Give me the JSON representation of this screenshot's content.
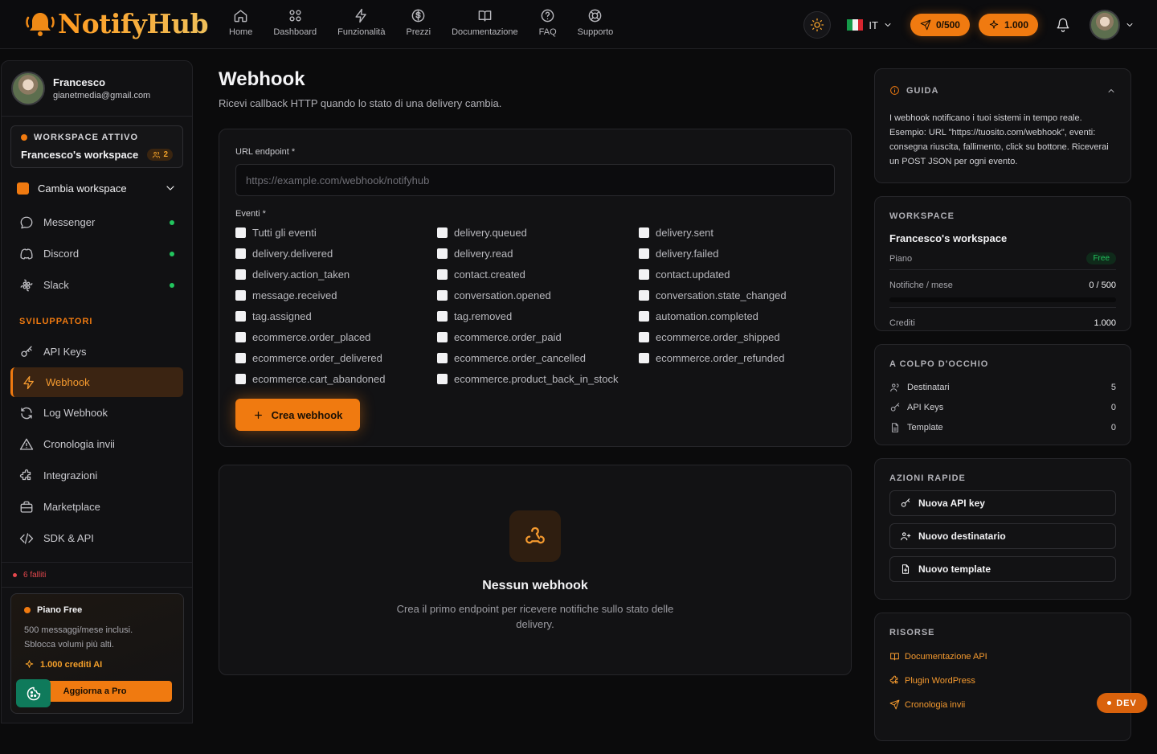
{
  "header": {
    "logo": "NotifyHub",
    "nav": [
      {
        "label": "Home",
        "icon": "home-icon"
      },
      {
        "label": "Dashboard",
        "icon": "grid-icon"
      },
      {
        "label": "Funzionalità",
        "icon": "bolt-icon"
      },
      {
        "label": "Prezzi",
        "icon": "dollar-icon"
      },
      {
        "label": "Documentazione",
        "icon": "book-icon"
      },
      {
        "label": "FAQ",
        "icon": "help-icon"
      },
      {
        "label": "Supporto",
        "icon": "lifebuoy-icon"
      }
    ],
    "language": "IT",
    "notifications_counter": "0/500",
    "credits_counter": "1.000"
  },
  "sidebar": {
    "user_name": "Francesco",
    "user_email": "gianetmedia@gmail.com",
    "workspace_label": "WORKSPACE ATTIVO",
    "workspace_name": "Francesco's workspace",
    "workspace_members": "2",
    "switch_label": "Cambia workspace",
    "channels": [
      {
        "label": "Messenger"
      },
      {
        "label": "Discord"
      },
      {
        "label": "Slack"
      }
    ],
    "dev_section": "SVILUPPATORI",
    "dev_items": [
      {
        "label": "API Keys"
      },
      {
        "label": "Webhook"
      },
      {
        "label": "Log Webhook"
      },
      {
        "label": "Cronologia invii"
      },
      {
        "label": "Integrazioni"
      },
      {
        "label": "Marketplace"
      },
      {
        "label": "SDK & API"
      }
    ],
    "failed": "6 falliti",
    "plan": {
      "title": "Piano Free",
      "desc_line1": "500 messaggi/mese inclusi.",
      "desc_line2": "Sblocca volumi più alti.",
      "ai_credits": "1.000 crediti AI",
      "upgrade": "Aggiorna a Pro"
    }
  },
  "main": {
    "title": "Webhook",
    "subtitle": "Ricevi callback HTTP quando lo stato di una delivery cambia.",
    "url_label": "URL endpoint *",
    "url_placeholder": "https://example.com/webhook/notifyhub",
    "events_label": "Eventi *",
    "events": [
      "Tutti gli eventi",
      "delivery.queued",
      "delivery.sent",
      "delivery.delivered",
      "delivery.read",
      "delivery.failed",
      "delivery.action_taken",
      "contact.created",
      "contact.updated",
      "message.received",
      "conversation.opened",
      "conversation.state_changed",
      "tag.assigned",
      "tag.removed",
      "automation.completed",
      "ecommerce.order_placed",
      "ecommerce.order_paid",
      "ecommerce.order_shipped",
      "ecommerce.order_delivered",
      "ecommerce.order_cancelled",
      "ecommerce.order_refunded",
      "ecommerce.cart_abandoned",
      "ecommerce.product_back_in_stock"
    ],
    "create_button": "Crea webhook",
    "empty_title": "Nessun webhook",
    "empty_desc": "Crea il primo endpoint per ricevere notifiche sullo stato delle delivery."
  },
  "right": {
    "guide_title": "GUIDA",
    "guide_text": "I webhook notificano i tuoi sistemi in tempo reale. Esempio: URL \"https://tuosito.com/webhook\", eventi: consegna riuscita, fallimento, click su bottone. Riceverai un POST JSON per ogni evento.",
    "ws_title": "WORKSPACE",
    "ws_name": "Francesco's workspace",
    "plan_label": "Piano",
    "plan_value": "Free",
    "notif_label": "Notifiche / mese",
    "notif_value": "0 / 500",
    "notif_fraction": 0,
    "credits_label": "Crediti",
    "credits_value": "1.000",
    "glance_title": "A COLPO D'OCCHIO",
    "glance": [
      {
        "label": "Destinatari",
        "value": "5"
      },
      {
        "label": "API Keys",
        "value": "0"
      },
      {
        "label": "Template",
        "value": "0"
      }
    ],
    "quick_title": "AZIONI RAPIDE",
    "quick": [
      "Nuova API key",
      "Nuovo destinatario",
      "Nuovo template"
    ],
    "res_title": "RISORSE",
    "resources": [
      "Documentazione API",
      "Plugin WordPress",
      "Cronologia invii"
    ]
  },
  "dev_badge": "DEV",
  "colors": {
    "accent": "#f07a10",
    "bg": "#0b0b0c",
    "success": "#22c55e",
    "danger": "#e5484d"
  }
}
